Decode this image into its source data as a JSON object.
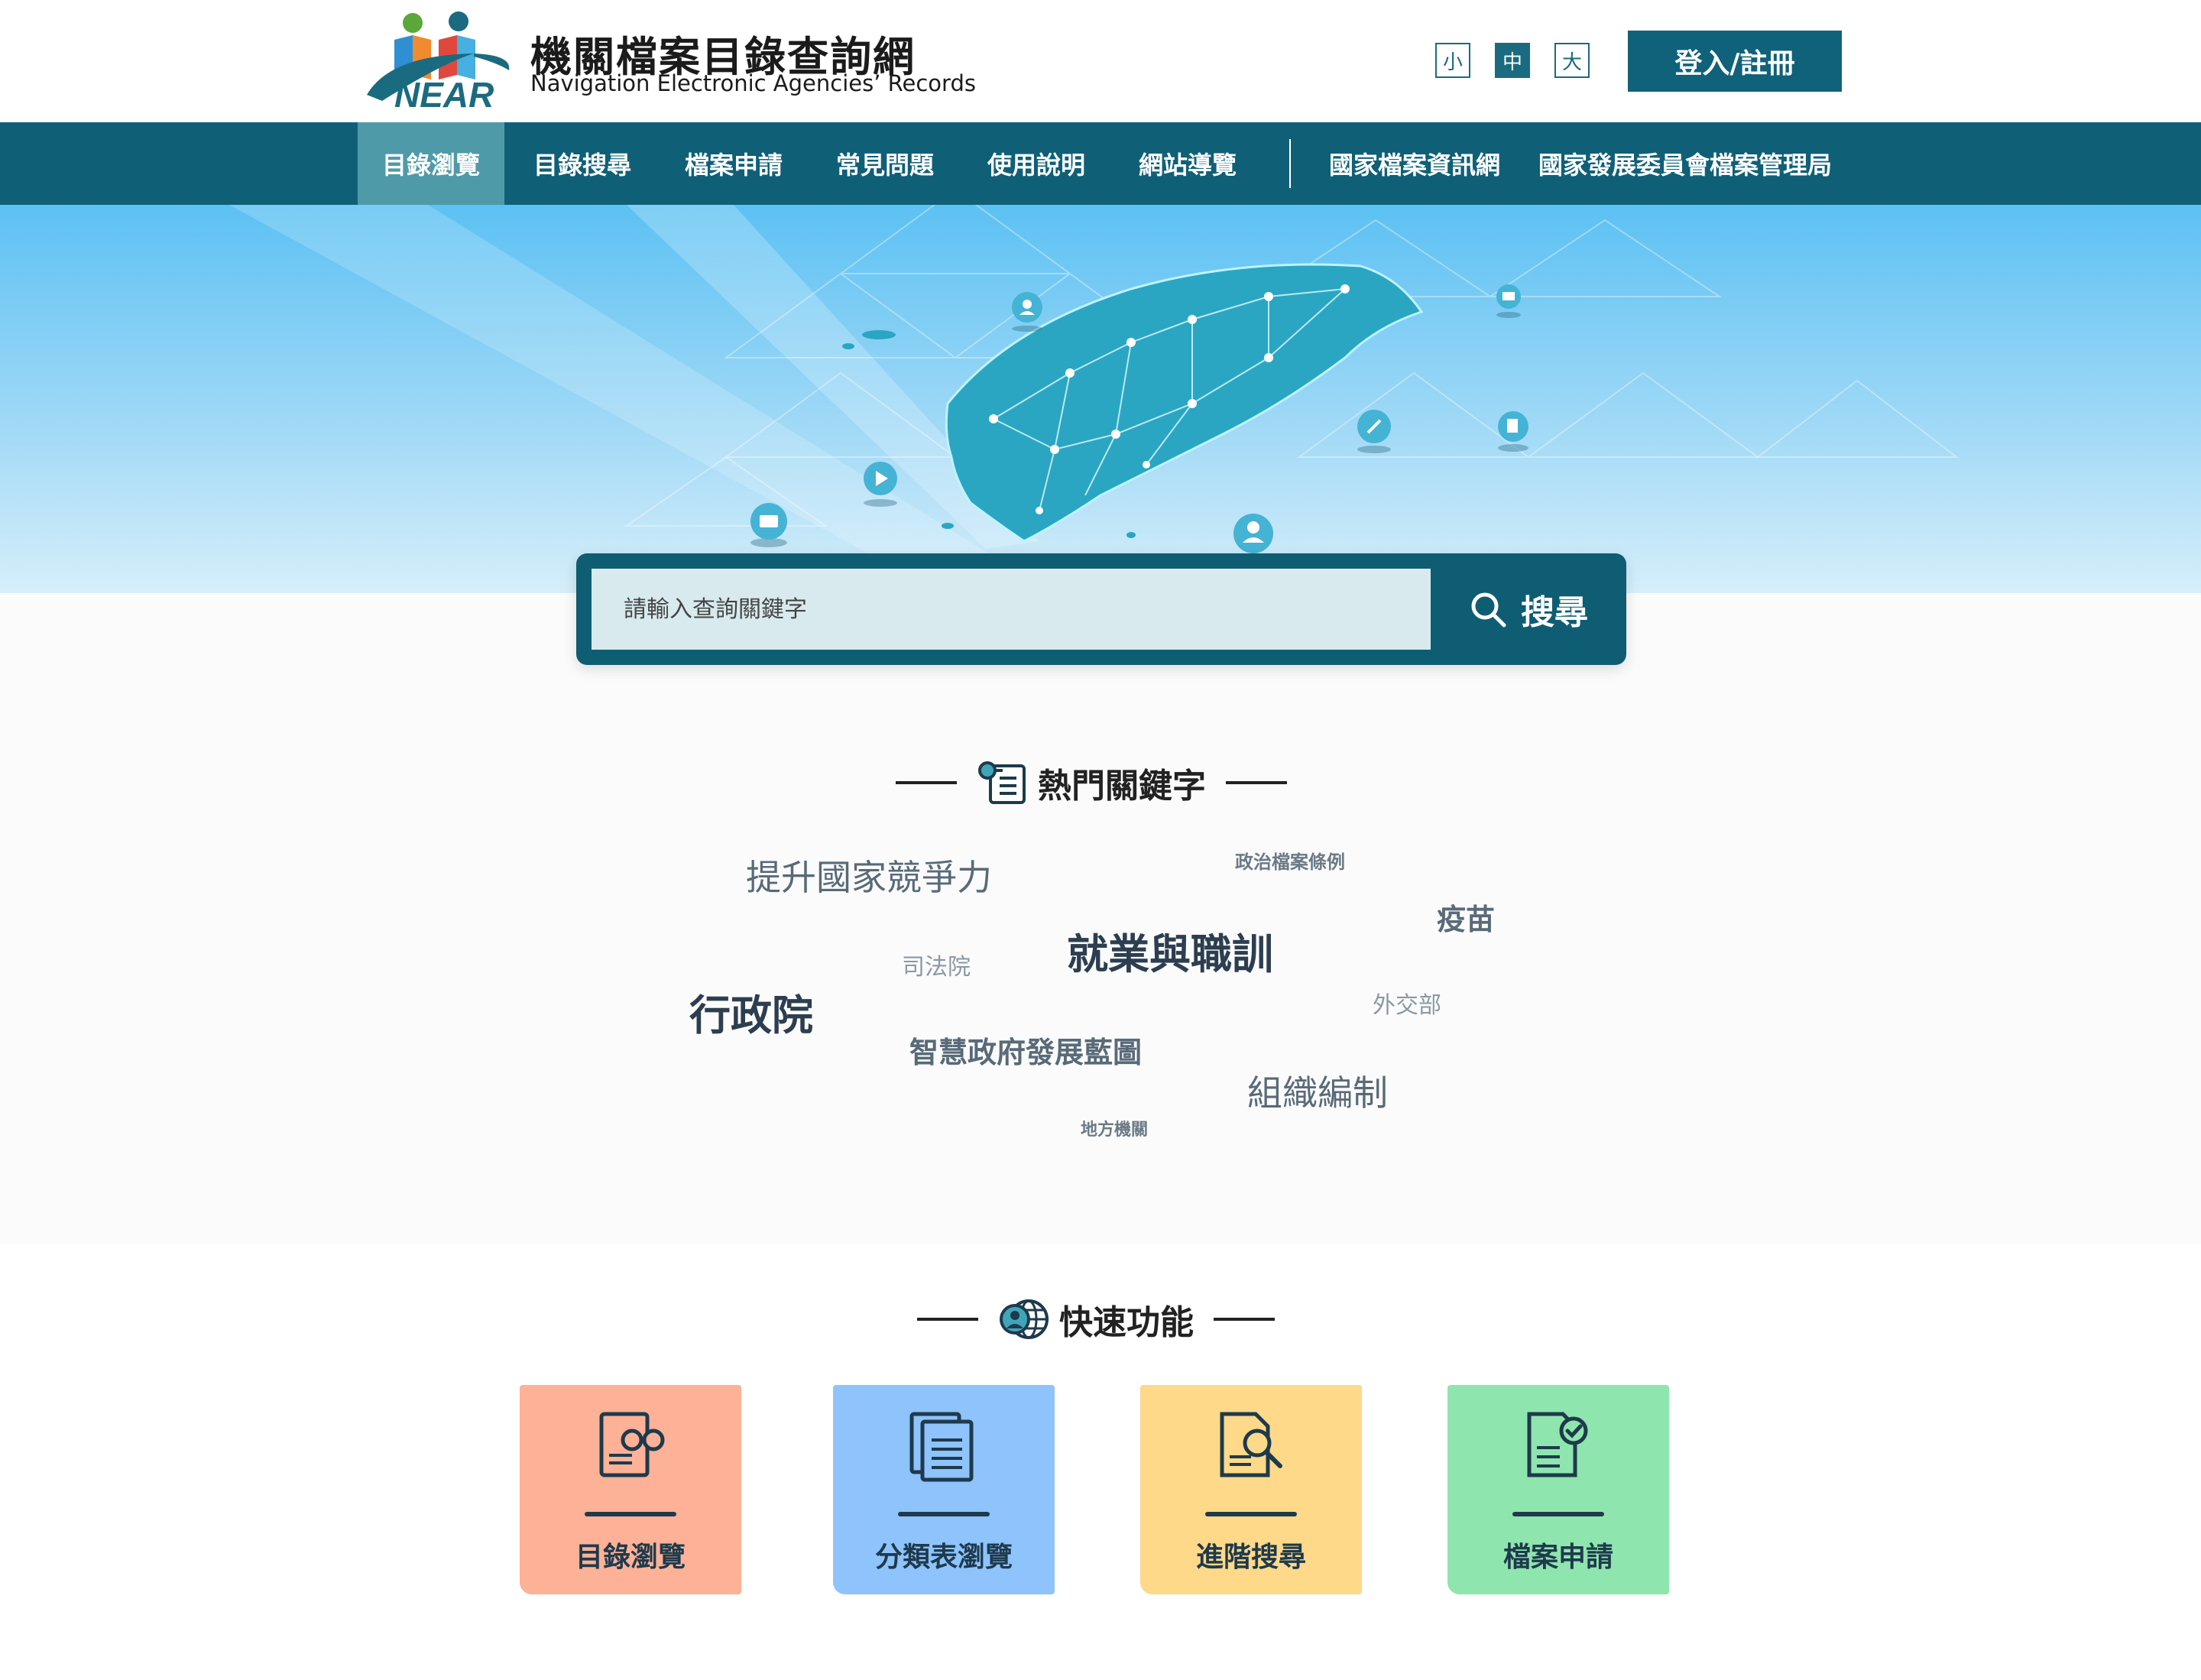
{
  "header": {
    "site_title": "機關檔案目錄查詢網",
    "site_subtitle": "Navigation Electronic Agencies’ Records",
    "logo_text": "NEAR",
    "font_sizes": [
      "小",
      "中",
      "大"
    ],
    "active_font_size": "中",
    "login_label": "登入/註冊"
  },
  "nav": {
    "items": [
      "目錄瀏覽",
      "目錄搜尋",
      "檔案申請",
      "常見問題",
      "使用說明",
      "網站導覽"
    ],
    "external_items": [
      "國家檔案資訊網",
      "國家發展委員會檔案管理局"
    ],
    "active_item": "目錄瀏覽"
  },
  "search": {
    "placeholder": "請輸入查詢關鍵字",
    "value": "",
    "button_label": "搜尋"
  },
  "hot_keywords": {
    "title": "熱門關鍵字",
    "items": [
      "提升國家競爭力",
      "政治檔案條例",
      "疫苗",
      "司法院",
      "就業與職訓",
      "行政院",
      "外交部",
      "智慧政府發展藍圖",
      "組織編制",
      "地方機關"
    ]
  },
  "quick": {
    "title": "快速功能",
    "cards": [
      {
        "label": "目錄瀏覽",
        "color": "#fdb196",
        "icon": "catalog-browse-icon"
      },
      {
        "label": "分類表瀏覽",
        "color": "#8ec3fb",
        "icon": "classification-browse-icon"
      },
      {
        "label": "進階搜尋",
        "color": "#fed989",
        "icon": "advanced-search-icon"
      },
      {
        "label": "檔案申請",
        "color": "#8fe5ae",
        "icon": "archive-apply-icon"
      }
    ]
  },
  "colors": {
    "brand": "#0f6077",
    "nav_active": "#4f9aa9"
  }
}
